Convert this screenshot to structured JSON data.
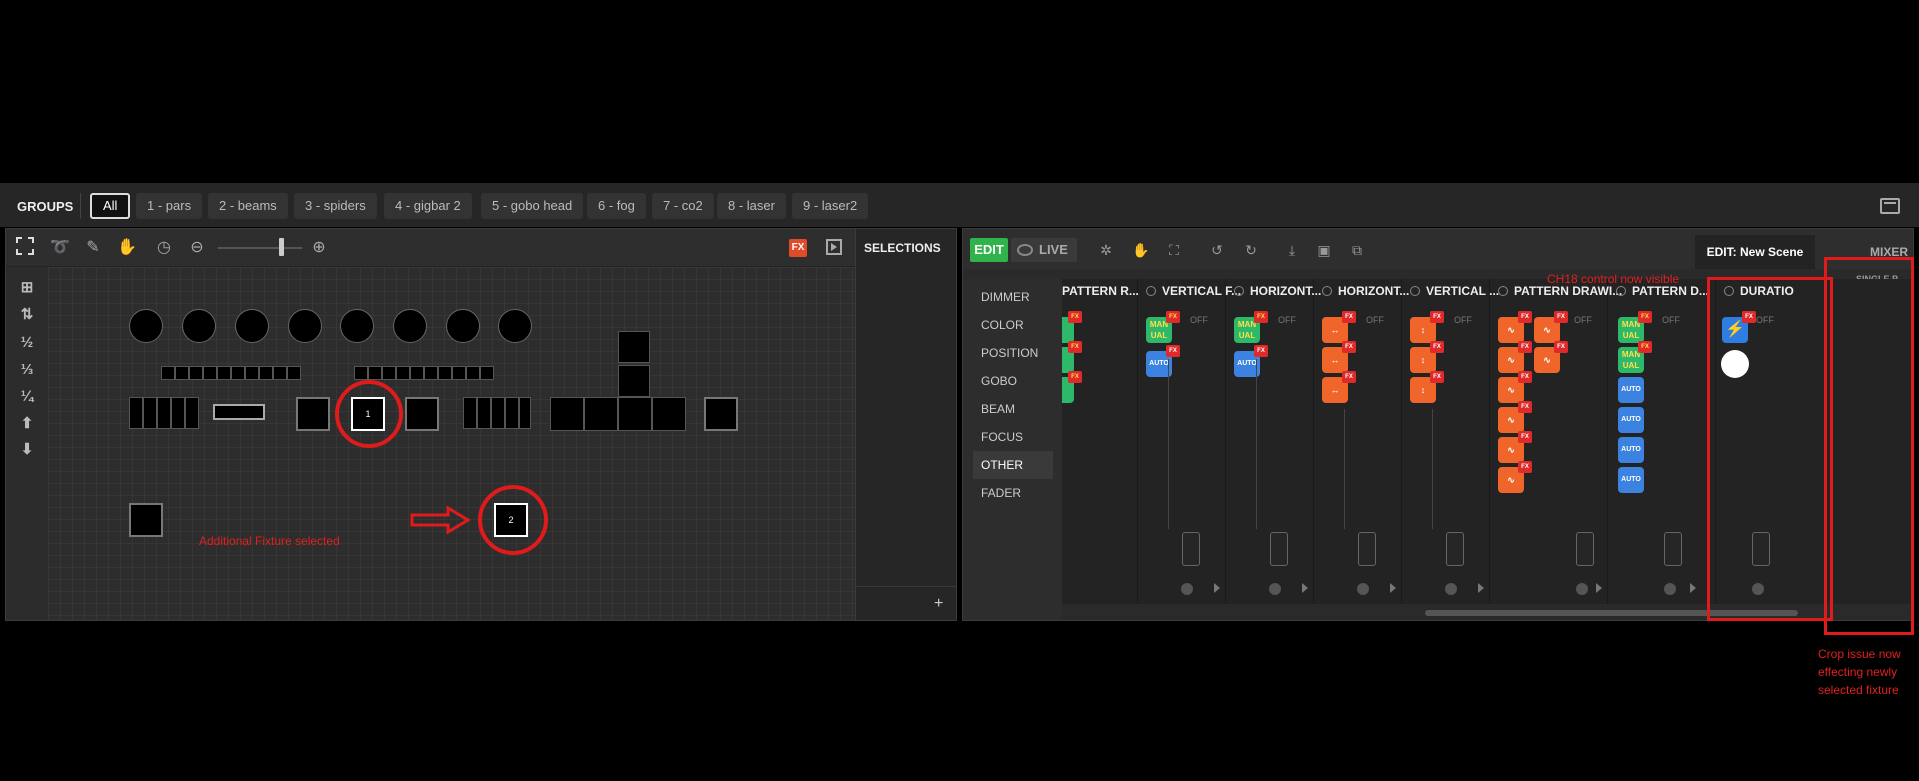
{
  "groups": {
    "title": "GROUPS",
    "items": [
      "All",
      "1 - pars",
      "2 - beams",
      "3 - spiders",
      "4 - gigbar 2",
      "5 - gobo head",
      "6 - fog",
      "7 - co2",
      "8 - laser",
      "9 - laser2"
    ],
    "active": "All"
  },
  "left_panel": {
    "fx_label": "FX",
    "selections_title": "SELECTIONS",
    "add_selection": "+",
    "fixture_numbers": [
      "1",
      "2"
    ],
    "annotation": "Additional Fixture selected",
    "side_tools": [
      "⊞",
      "⇅",
      "½",
      "⅓",
      "¼",
      "⬆",
      "⬇"
    ]
  },
  "right_panel": {
    "edit_label": "EDIT",
    "live_label": "LIVE",
    "tab_edit_scene": "EDIT: New Scene",
    "tab_mixer": "MIXER",
    "single_label": "SINGLE P",
    "categories": [
      "DIMMER",
      "COLOR",
      "POSITION",
      "GOBO",
      "BEAM",
      "FOCUS",
      "OTHER",
      "FADER"
    ],
    "active_category": "OTHER",
    "channels": [
      {
        "title": "PATTERN R...",
        "off": ""
      },
      {
        "title": "VERTICAL F...",
        "off": "OFF"
      },
      {
        "title": "HORIZONT...",
        "off": "OFF"
      },
      {
        "title": "HORIZONT...",
        "off": "OFF"
      },
      {
        "title": "VERTICAL ...",
        "off": "OFF"
      },
      {
        "title": "PATTERN DRAWI...",
        "off": "OFF"
      },
      {
        "title": "PATTERN D...",
        "off": "OFF"
      },
      {
        "title": "DURATIO",
        "off": "OFF"
      }
    ],
    "button_labels": {
      "manual": "MAN UAL",
      "auto": "AUTO",
      "fx": "FX"
    },
    "annotation_ch18": "CH18 control now visible",
    "annotation_crop": [
      "Crop issue now",
      "effecting newly",
      "selected fixture"
    ]
  },
  "colors": {
    "accent_green": "#2fb34a",
    "annotation_red": "#e01b1b",
    "fx_orange": "#f0662a",
    "auto_blue": "#3c82e0"
  }
}
